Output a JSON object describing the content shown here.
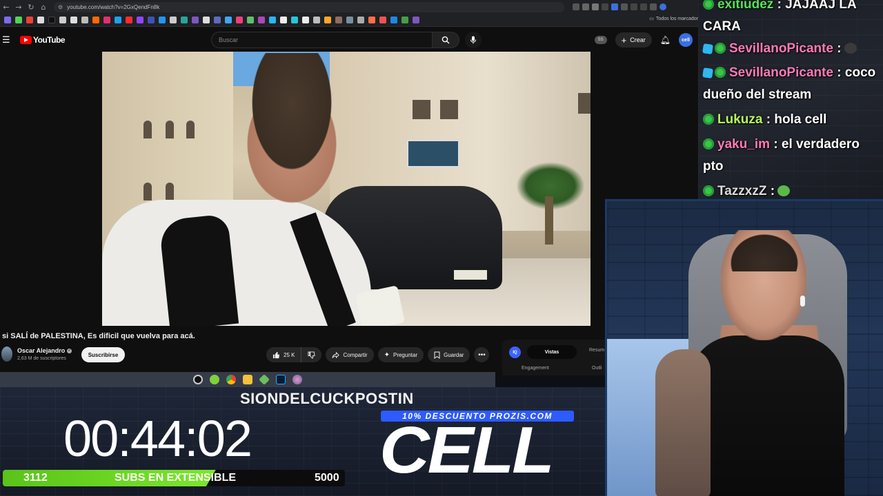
{
  "browser": {
    "url": "youtube.com/watch?v=2GxQendFn8k",
    "bookmarks_all": "Todos los marcador"
  },
  "youtube": {
    "logo_text": "YouTube",
    "search_placeholder": "Buscar",
    "ss_badge": "SS",
    "create_label": "Crear",
    "avatar_text": "cell"
  },
  "video": {
    "title": "si SALÍ de PALESTINA, Es dificil que vuelva para acá.",
    "channel_name": "Oscar Alejandro",
    "subscribers": "2,63 M de suscriptores",
    "subscribe_label": "Suscribirse",
    "like_count": "25 K",
    "share_label": "Compartir",
    "ask_label": "Preguntar",
    "save_label": "Guardar"
  },
  "side_panel": {
    "iq": "IQ",
    "tab_active": "Vistas",
    "tab_other": "Resum",
    "label_engagement": "Engagement",
    "label_outliers": "Outli"
  },
  "overlay": {
    "marquee": "SIONDELCUCKPOSTIN",
    "timer": "00:44:02",
    "discount": "10% DESCUENTO PROZIS.COM",
    "brand": "CELL",
    "subs_current": "3112",
    "subs_label": "SUBS EN EXTENSIBLE",
    "subs_goal": "5000",
    "subs_progress": 0.6224
  },
  "chat": {
    "messages": [
      {
        "user": "exitiudez",
        "text": ": JAJAAJ LA CARA",
        "color": "#5ae05a",
        "badges": [
          "sub"
        ]
      },
      {
        "user": "SevillanoPicante",
        "text": ":",
        "color": "#ff7ab8",
        "badges": [
          "cube",
          "sub"
        ],
        "emote": "cat"
      },
      {
        "user": "SevillanoPicante",
        "text": ": coco dueño del stream",
        "color": "#ff7ab8",
        "badges": [
          "cube",
          "sub"
        ]
      },
      {
        "user": "Lukuza",
        "text": ": hola cell",
        "color": "#b6ff5a",
        "badges": [
          "sub"
        ]
      },
      {
        "user": "yaku_im",
        "text": ": el verdadero pto",
        "color": "#ff7ab8",
        "badges": [
          "sub"
        ]
      },
      {
        "user": "TazzxzZ",
        "text": ":",
        "color": "#dcdcdc",
        "badges": [
          "sub"
        ],
        "emote": "frog"
      }
    ]
  },
  "colors": {
    "yt_red": "#ff0000",
    "sub_bar_green": "#6fdc24",
    "discount_blue": "#2d5bff",
    "chat_badge_green": "#39c54a"
  }
}
